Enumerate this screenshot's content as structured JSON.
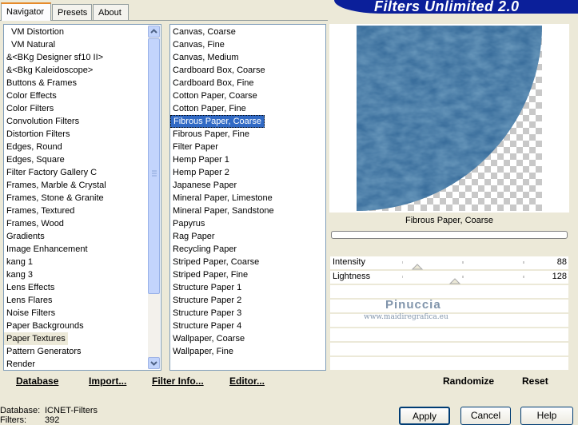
{
  "tabs": [
    "Navigator",
    "Presets",
    "About"
  ],
  "app_title": "Filters Unlimited 2.0",
  "categories": [
    "VM Distortion",
    "VM Natural",
    "&<BKg Designer sf10 II>",
    "&<Bkg Kaleidoscope>",
    "Buttons & Frames",
    "Color Effects",
    "Color Filters",
    "Convolution Filters",
    "Distortion Filters",
    "Edges, Round",
    "Edges, Square",
    "Filter Factory Gallery C",
    "Frames, Marble & Crystal",
    "Frames, Stone & Granite",
    "Frames, Textured",
    "Frames, Wood",
    "Gradients",
    "Image Enhancement",
    "kang 1",
    "kang 3",
    "Lens Effects",
    "Lens Flares",
    "Noise Filters",
    "Paper Backgrounds",
    "Paper Textures",
    "Pattern Generators",
    "Render"
  ],
  "selected_category": "Paper Textures",
  "filters": [
    "Canvas, Coarse",
    "Canvas, Fine",
    "Canvas, Medium",
    "Cardboard Box, Coarse",
    "Cardboard Box, Fine",
    "Cotton Paper, Coarse",
    "Cotton Paper, Fine",
    "Fibrous Paper, Coarse",
    "Fibrous Paper, Fine",
    "Filter Paper",
    "Hemp Paper 1",
    "Hemp Paper 2",
    "Japanese Paper",
    "Mineral Paper, Limestone",
    "Mineral Paper, Sandstone",
    "Papyrus",
    "Rag Paper",
    "Recycling Paper",
    "Striped Paper, Coarse",
    "Striped Paper, Fine",
    "Structure Paper 1",
    "Structure Paper 2",
    "Structure Paper 3",
    "Structure Paper 4",
    "Wallpaper, Coarse",
    "Wallpaper, Fine"
  ],
  "selected_filter": "Fibrous Paper, Coarse",
  "preview_caption": "Fibrous Paper, Coarse",
  "params": [
    {
      "label": "Intensity",
      "value": "88"
    },
    {
      "label": "Lightness",
      "value": "128"
    }
  ],
  "watermark": {
    "line1": "Pinuccia",
    "line2": "www.maidiregrafica.eu"
  },
  "bottom_links": {
    "database": "Database",
    "import": "Import...",
    "filter_info": "Filter Info...",
    "editor": "Editor...",
    "randomize": "Randomize",
    "reset": "Reset"
  },
  "buttons": {
    "apply": "Apply",
    "cancel": "Cancel",
    "help": "Help"
  },
  "status": {
    "database_label": "Database:",
    "database_value": "ICNET-Filters",
    "filters_label": "Filters:",
    "filters_value": "392"
  },
  "colors": {
    "selection": "#316ac5",
    "banner": "#0b1f9a",
    "texture": "#3a6e9c"
  }
}
